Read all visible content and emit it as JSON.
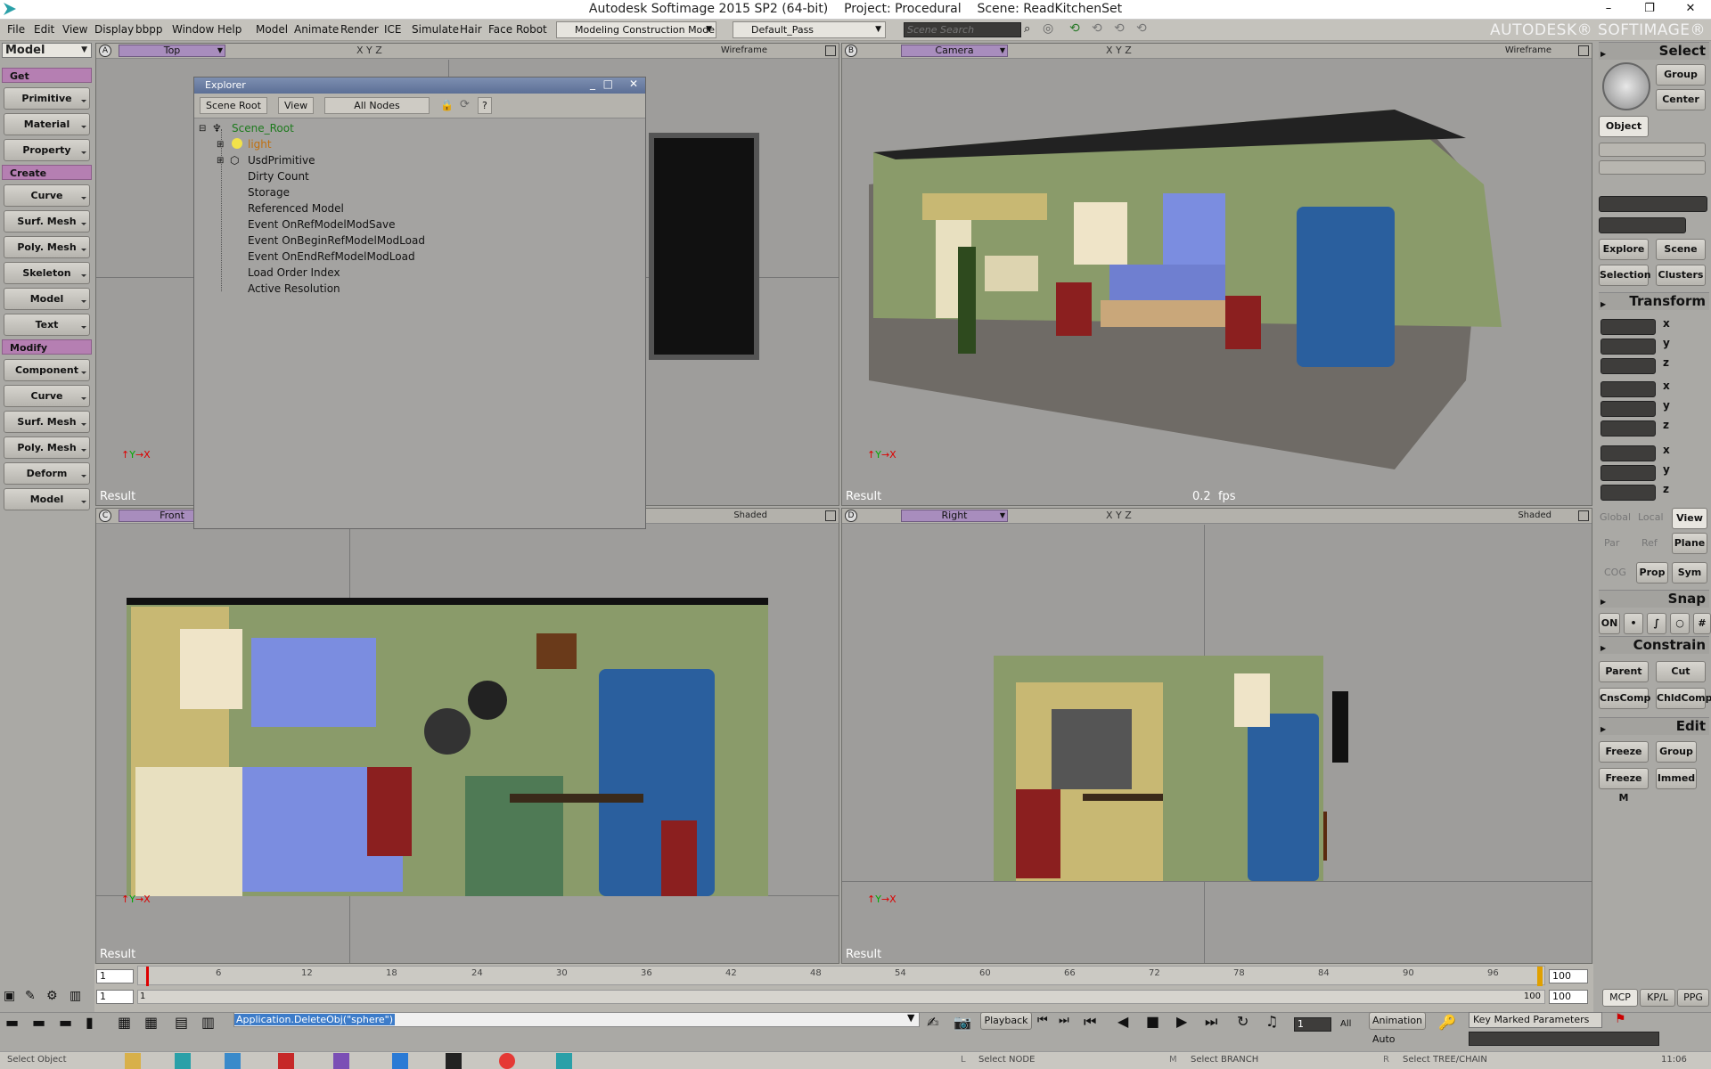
{
  "window": {
    "title": "Autodesk Softimage 2015 SP2 (64-bit)    Project: Procedural    Scene: ReadKitchenSet",
    "brand": "AUTODESK® SOFTIMAGE®",
    "minimize": "–",
    "maximize": "❐",
    "close": "✕"
  },
  "menubar": {
    "items": [
      "File",
      "Edit",
      "View",
      "Display",
      "bbpp",
      "Window",
      "Help",
      "Model",
      "Animate",
      "Render",
      "ICE",
      "Simulate",
      "Hair",
      "Face Robot"
    ],
    "construction_mode": "Modeling Construction Mode",
    "pass": "Default_Pass",
    "scene_search_placeholder": "Scene Search"
  },
  "leftbar": {
    "mode": "Model",
    "get_header": "Get",
    "get_items": [
      "Primitive",
      "Material",
      "Property"
    ],
    "create_header": "Create",
    "create_items": [
      "Curve",
      "Surf. Mesh",
      "Poly. Mesh",
      "Skeleton",
      "Model",
      "Text"
    ],
    "modify_header": "Modify",
    "modify_items": [
      "Component",
      "Curve",
      "Surf. Mesh",
      "Poly. Mesh",
      "Deform",
      "Model"
    ]
  },
  "viewports": {
    "A": {
      "letter": "A",
      "camera": "Top",
      "mode": "Wireframe",
      "label": "Result"
    },
    "B": {
      "letter": "B",
      "camera": "Camera",
      "mode": "Wireframe",
      "label": "Result",
      "fps": "0.2  fps"
    },
    "C": {
      "letter": "C",
      "camera": "Front",
      "mode": "Shaded",
      "label": "Result"
    },
    "D": {
      "letter": "D",
      "camera": "Right",
      "mode": "Shaded",
      "label": "Result"
    },
    "xyz": "X Y Z"
  },
  "explorer": {
    "title": "Explorer",
    "scope": "Scene Root",
    "view": "View",
    "filter": "All Nodes",
    "help": "?",
    "nodes": [
      {
        "label": "Scene_Root",
        "color": "#1d7a1d"
      },
      {
        "label": "light",
        "color": "#c07010"
      },
      {
        "label": "UsdPrimitive",
        "color": "#111111"
      },
      {
        "label": "Dirty Count",
        "color": "#111111"
      },
      {
        "label": "Storage",
        "color": "#111111"
      },
      {
        "label": "Referenced Model",
        "color": "#111111"
      },
      {
        "label": "Event OnRefModelModSave",
        "color": "#111111"
      },
      {
        "label": "Event OnBeginRefModelModLoad",
        "color": "#111111"
      },
      {
        "label": "Event OnEndRefModelModLoad",
        "color": "#111111"
      },
      {
        "label": "Load Order Index",
        "color": "#111111"
      },
      {
        "label": "Active Resolution",
        "color": "#111111"
      }
    ]
  },
  "rightbar": {
    "select_header": "Select",
    "group": "Group",
    "center": "Center",
    "object": "Object",
    "explore": "Explore",
    "scene": "Scene",
    "selection": "Selection",
    "clusters": "Clusters",
    "transform_header": "Transform",
    "axes": [
      "x",
      "y",
      "z"
    ],
    "global": "Global",
    "local": "Local",
    "view": "View",
    "par": "Par",
    "ref": "Ref",
    "plane": "Plane",
    "cog": "COG",
    "prop": "Prop",
    "sym": "Sym",
    "snap_header": "Snap",
    "on": "ON",
    "constrain_header": "Constrain",
    "parent": "Parent",
    "cut": "Cut",
    "cnscomp": "CnsComp",
    "chldcomp": "ChldComp",
    "edit_header": "Edit",
    "freeze": "Freeze",
    "edit_group": "Group",
    "freeze_m": "Freeze M",
    "immed": "Immed"
  },
  "timeline": {
    "start": "1",
    "current": "1",
    "end": "100",
    "end2": "100",
    "range_end": "100",
    "ticks": [
      "6",
      "12",
      "18",
      "24",
      "30",
      "36",
      "42",
      "48",
      "54",
      "60",
      "66",
      "72",
      "78",
      "84",
      "90",
      "96"
    ],
    "slider_start": "1"
  },
  "bottom": {
    "command": "Application.DeleteObj(\"sphere\")",
    "playback": "Playback",
    "frame": "1",
    "all": "All",
    "animation": "Animation",
    "auto": "Auto",
    "key_marked": "Key Marked Parameters",
    "mcp": "MCP",
    "kpl": "KP/L",
    "ppg": "PPG"
  },
  "status": {
    "left": "Select Object",
    "l": "L",
    "select_node": "Select NODE",
    "m": "M",
    "select_branch": "Select BRANCH",
    "r": "R",
    "select_tree": "Select TREE/CHAIN",
    "clock": "11:06"
  },
  "colors": {
    "accent_purple": "#b57fb2",
    "camera_bar": "#a88dbd",
    "wall_green": "#8a9b6a",
    "fridge_blue": "#2a5f9e",
    "curtain_blue": "#7b8de0"
  }
}
